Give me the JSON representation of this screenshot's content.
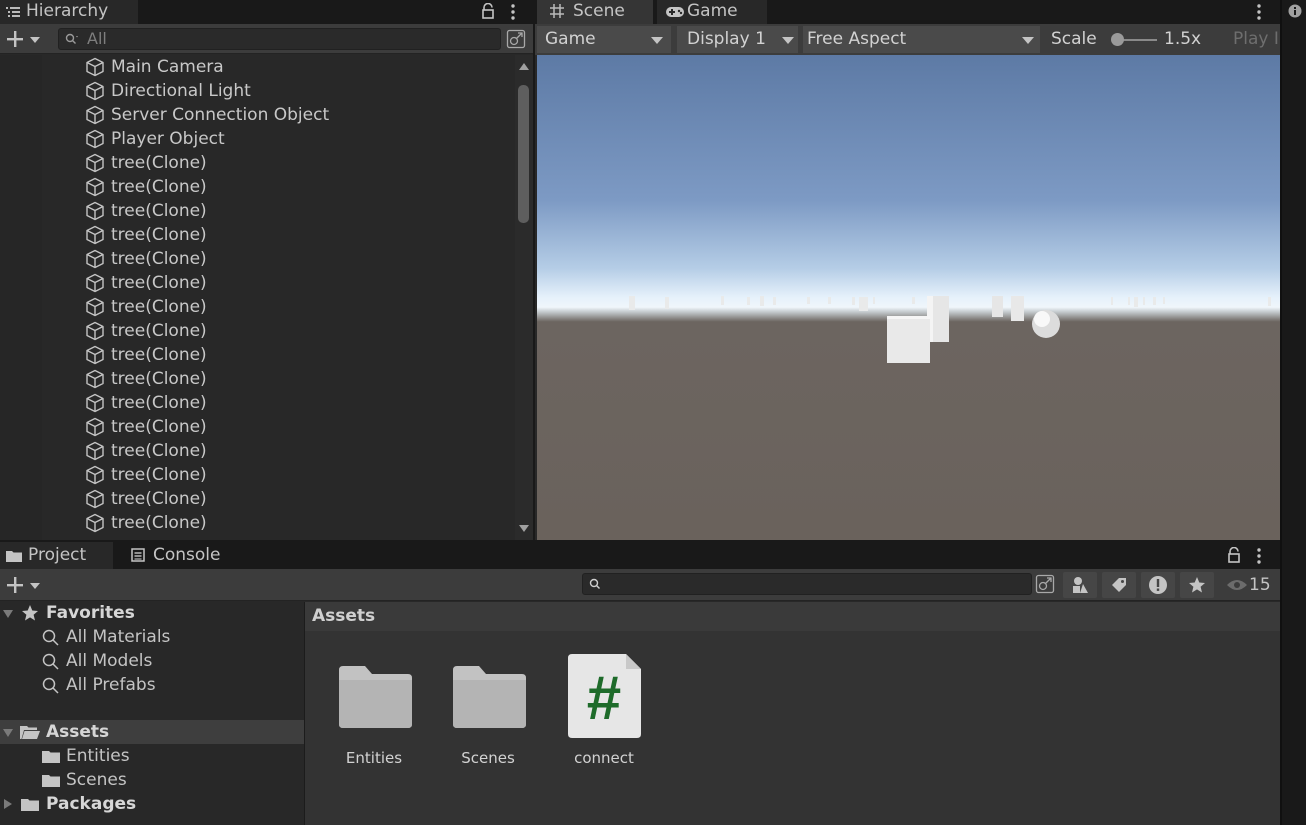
{
  "hierarchy": {
    "tab_label": "Hierarchy",
    "search_placeholder": "All",
    "items": [
      "Main Camera",
      "Directional Light",
      "Server Connection Object",
      "Player Object",
      "tree(Clone)",
      "tree(Clone)",
      "tree(Clone)",
      "tree(Clone)",
      "tree(Clone)",
      "tree(Clone)",
      "tree(Clone)",
      "tree(Clone)",
      "tree(Clone)",
      "tree(Clone)",
      "tree(Clone)",
      "tree(Clone)",
      "tree(Clone)",
      "tree(Clone)",
      "tree(Clone)",
      "tree(Clone)"
    ]
  },
  "view_tabs": {
    "scene": "Scene",
    "game": "Game"
  },
  "game_toolbar": {
    "mode": "Game",
    "display": "Display 1",
    "aspect": "Free Aspect",
    "scale_label": "Scale",
    "scale_value": "1.5x",
    "play_label": "Play I"
  },
  "project": {
    "tab_project": "Project",
    "tab_console": "Console",
    "badge_count": "15",
    "favorites_label": "Favorites",
    "favorites": [
      "All Materials",
      "All Models",
      "All Prefabs"
    ],
    "assets_label": "Assets",
    "assets_children": [
      "Entities",
      "Scenes"
    ],
    "packages_label": "Packages",
    "assets_header": "Assets",
    "asset_items": [
      {
        "name": "Entities",
        "icon": "folder-icon"
      },
      {
        "name": "Scenes",
        "icon": "folder-icon"
      },
      {
        "name": "connect",
        "icon": "csharp-script-icon"
      }
    ]
  },
  "colors": {
    "panel_bg": "#282828",
    "toolbar_bg": "#3c3c3c",
    "selected_row": "#3e3e3e",
    "script_hash": "#1e6b2a"
  }
}
